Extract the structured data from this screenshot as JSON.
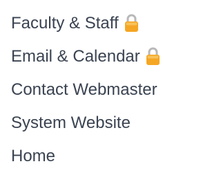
{
  "menu": {
    "items": [
      {
        "label": "Faculty & Staff",
        "locked": true
      },
      {
        "label": "Email & Calendar",
        "locked": true
      },
      {
        "label": "Contact Webmaster",
        "locked": false
      },
      {
        "label": "System Website",
        "locked": false
      },
      {
        "label": "Home",
        "locked": false
      }
    ]
  },
  "icons": {
    "lock": "lock-icon"
  },
  "colors": {
    "text": "#3a4351",
    "lock_body": "#f5a623",
    "lock_shackle": "#b8b8b8"
  }
}
